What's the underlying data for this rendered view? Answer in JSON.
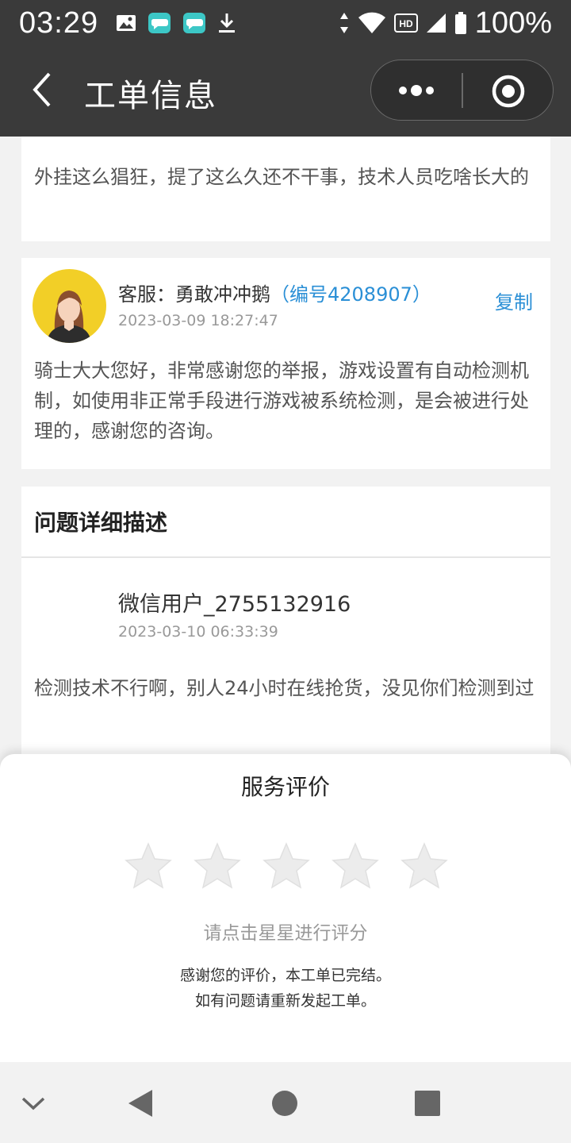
{
  "status_bar": {
    "time": "03:29",
    "battery_text": "100%",
    "icons_left": [
      "image-icon",
      "message-icon",
      "message-icon",
      "download-icon"
    ],
    "icons_right": [
      "data-arrows-icon",
      "wifi-icon",
      "hd-icon",
      "signal-icon",
      "battery-icon"
    ],
    "hd_label": "HD"
  },
  "nav": {
    "title": "工单信息",
    "back_icon": "chevron-left-icon",
    "more_icon": "more-dots-icon",
    "close_icon": "target-close-icon"
  },
  "messages": {
    "previous_user": {
      "text": "外挂这么猖狂，提了这么久还不干事，技术人员吃啥长大的"
    },
    "agent_reply": {
      "name_prefix": "客服：勇敢冲冲鹅",
      "agent_number": "（编号4208907）",
      "time": "2023-03-09 18:27:47",
      "copy_label": "复制",
      "text": "骑士大大您好，非常感谢您的举报，游戏设置有自动检测机制，如使用非正常手段进行游戏被系统检测，是会被进行处理的，感谢您的咨询。"
    }
  },
  "detail": {
    "section_title": "问题详细描述",
    "user_name": "微信用户_2755132916",
    "time": "2023-03-10 06:33:39",
    "text": "检测技术不行啊，别人24小时在线抢货，没见你们检测到过"
  },
  "rating": {
    "title": "服务评价",
    "stars_total": 5,
    "stars_selected": 0,
    "hint": "请点击星星进行评分",
    "thanks_line1": "感谢您的评价，本工单已完结。",
    "thanks_line2": "如有问题请重新发起工单。"
  },
  "system_nav": {
    "buttons": [
      "chevron-down-icon",
      "back-triangle-icon",
      "home-circle-icon",
      "recents-square-icon"
    ]
  },
  "colors": {
    "header_bg": "#3a3a3a",
    "accent_blue": "#2a8fd6",
    "page_bg": "#f2f2f2",
    "avatar_bg": "#f2cf27"
  }
}
